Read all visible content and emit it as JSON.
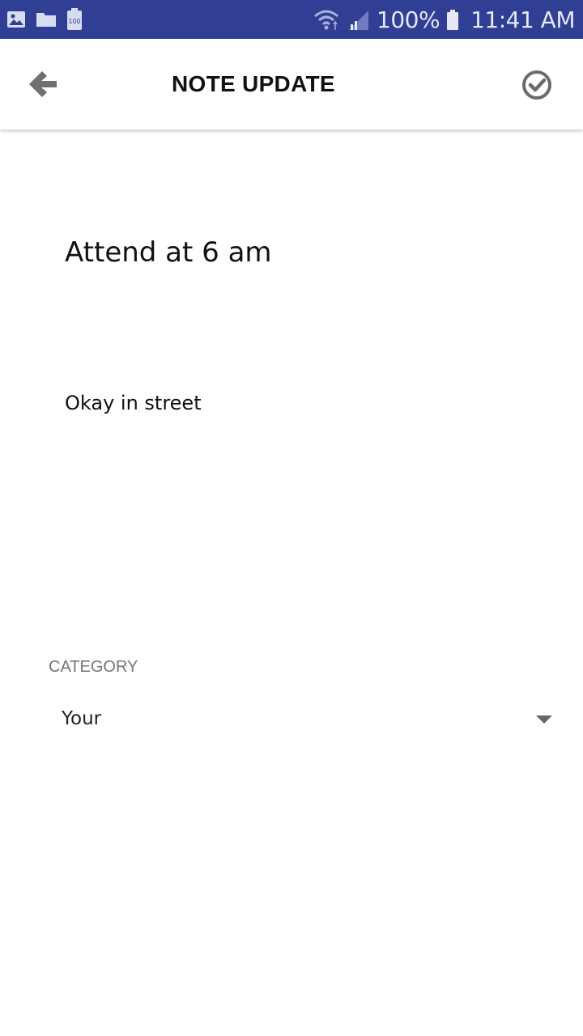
{
  "status_bar": {
    "battery_percent": "100%",
    "time": "11:41 AM",
    "icons": [
      "image-icon",
      "folder-icon",
      "battery-100-notification-icon",
      "wifi-icon",
      "signal-icon",
      "battery-icon"
    ],
    "background": "#303f94"
  },
  "app_bar": {
    "title": "NOTE UPDATE",
    "back_icon": "arrow-left-icon",
    "confirm_icon": "check-circle-icon"
  },
  "note": {
    "title": "Attend at 6 am",
    "body": "Okay in street"
  },
  "category": {
    "label": "CATEGORY",
    "selected": "Your"
  }
}
